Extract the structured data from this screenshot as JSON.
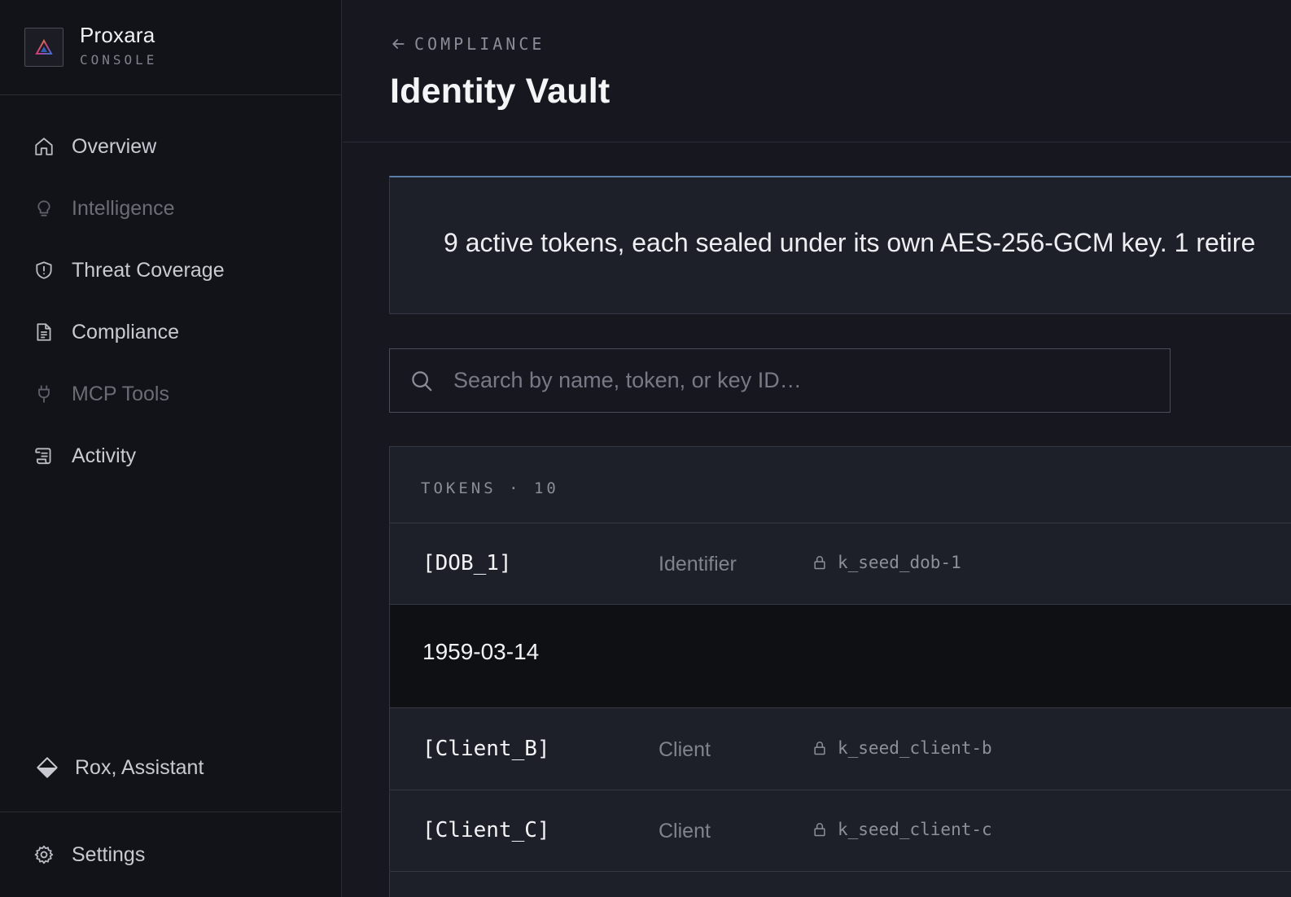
{
  "brand": {
    "name": "Proxara",
    "sub": "CONSOLE"
  },
  "nav": {
    "items": [
      {
        "label": "Overview",
        "icon": "home-icon",
        "dim": false
      },
      {
        "label": "Intelligence",
        "icon": "lightbulb-icon",
        "dim": true
      },
      {
        "label": "Threat Coverage",
        "icon": "shield-alert-icon",
        "dim": false
      },
      {
        "label": "Compliance",
        "icon": "document-icon",
        "dim": false
      },
      {
        "label": "MCP Tools",
        "icon": "plug-icon",
        "dim": true
      },
      {
        "label": "Activity",
        "icon": "scroll-icon",
        "dim": false
      }
    ],
    "assistant": {
      "label": "Rox, Assistant",
      "icon": "diamond-icon"
    },
    "settings": {
      "label": "Settings",
      "icon": "gear-icon"
    }
  },
  "header": {
    "breadcrumb": "COMPLIANCE",
    "title": "Identity Vault"
  },
  "banner": {
    "text": "9 active tokens, each sealed under its own AES-256-GCM key. 1 retire"
  },
  "search": {
    "placeholder": "Search by name, token, or key ID…",
    "value": ""
  },
  "tokens": {
    "heading": "TOKENS · 10",
    "rows": [
      {
        "token": "[DOB_1]",
        "type": "Identifier",
        "key": "k_seed_dob-1"
      },
      {
        "token": "[Client_B]",
        "type": "Client",
        "key": "k_seed_client-b"
      },
      {
        "token": "[Client_C]",
        "type": "Client",
        "key": "k_seed_client-c"
      }
    ],
    "expanded_value": "1959-03-14"
  }
}
